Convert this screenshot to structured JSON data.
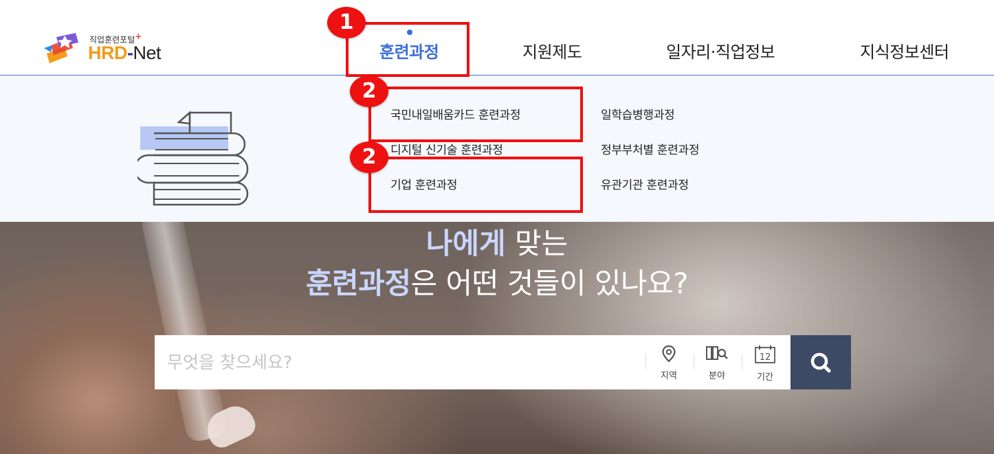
{
  "logo": {
    "subtitle": "직업훈련포털",
    "plus": "+",
    "hrd": "HRD",
    "dash": "-",
    "net": "Net"
  },
  "gnb": {
    "items": [
      {
        "label": "훈련과정",
        "active": true
      },
      {
        "label": "지원제도"
      },
      {
        "label": "일자리·직업정보"
      },
      {
        "label": "지식정보센터"
      }
    ]
  },
  "dropdown": {
    "left": [
      "국민내일배움카드 훈련과정",
      "디지털 신기술 훈련과정",
      "기업 훈련과정"
    ],
    "right": [
      "일학습병행과정",
      "정부부처별 훈련과정",
      "유관기관 훈련과정"
    ]
  },
  "hero": {
    "line1_bold": "나에게",
    "line1_rest": " 맞는",
    "line2_bold": "훈련과정",
    "line2_rest": "은 어떤 것들이 있나요?"
  },
  "search": {
    "placeholder": "무엇을 찾으세요?",
    "filters": [
      {
        "label": "지역",
        "icon": "location-pin-icon"
      },
      {
        "label": "분야",
        "icon": "field-category-icon"
      },
      {
        "label": "기간",
        "icon": "calendar-icon",
        "day": "12"
      }
    ]
  },
  "annotations": {
    "badge1": "1",
    "badge2a": "2",
    "badge2b": "2"
  },
  "colors": {
    "accent": "#3b6fd8",
    "annotation": "#ee1111",
    "search_button": "#3d4a66",
    "logo_orange": "#f39a1c"
  }
}
